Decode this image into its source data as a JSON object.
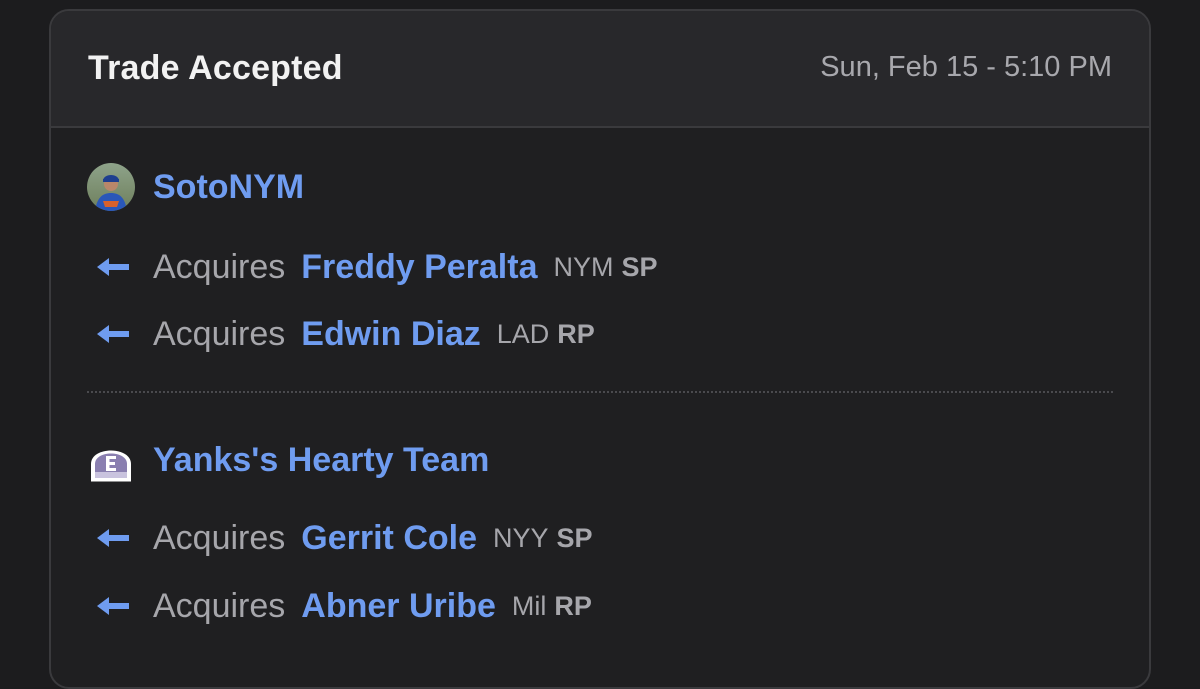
{
  "header": {
    "title": "Trade Accepted",
    "timestamp": "Sun, Feb 15 - 5:10 PM"
  },
  "teams": [
    {
      "name": "SotoNYM",
      "avatar_icon": "player-photo-avatar",
      "acquisitions": [
        {
          "action": "Acquires",
          "player": "Freddy Peralta",
          "team": "NYM",
          "position": "SP"
        },
        {
          "action": "Acquires",
          "player": "Edwin Diaz",
          "team": "LAD",
          "position": "RP"
        }
      ]
    },
    {
      "name": "Yanks's Hearty Team",
      "avatar_icon": "espn-cap-icon",
      "acquisitions": [
        {
          "action": "Acquires",
          "player": "Gerrit Cole",
          "team": "NYY",
          "position": "SP"
        },
        {
          "action": "Acquires",
          "player": "Abner Uribe",
          "team": "Mil",
          "position": "RP"
        }
      ]
    }
  ],
  "colors": {
    "accent": "#6f9cf0",
    "background": "#1c1c1e",
    "card": "#1f1f21",
    "header": "#28282b",
    "muted_text": "#a6a6ab"
  }
}
